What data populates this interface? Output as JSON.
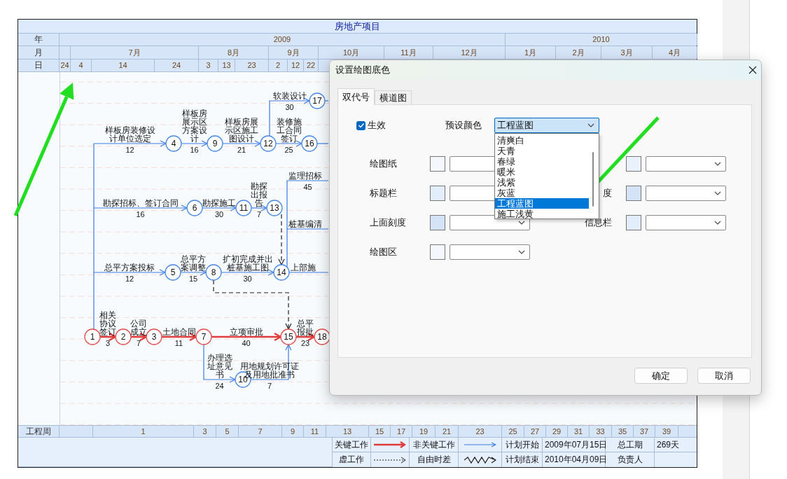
{
  "chart": {
    "title": "房地产项目",
    "scale": {
      "year_label": "年",
      "years": [
        "2009",
        "2010"
      ],
      "month_label": "月",
      "months": [
        "7月",
        "8月",
        "9月",
        "10月",
        "11月",
        "12月",
        "1月",
        "2月",
        "3月",
        "4月"
      ],
      "day_label": "日",
      "days": [
        "24",
        "4",
        "14",
        "24",
        "3",
        "13",
        "23",
        "2",
        "12",
        "22"
      ]
    },
    "nodes": [
      {
        "label": "1",
        "critical": true
      },
      {
        "label": "2",
        "critical": true
      },
      {
        "label": "3",
        "critical": true
      },
      {
        "label": "7",
        "critical": true
      },
      {
        "label": "15",
        "critical": true
      },
      {
        "label": "18",
        "critical": true
      },
      {
        "label": "4",
        "critical": false
      },
      {
        "label": "9",
        "critical": false
      },
      {
        "label": "12",
        "critical": false
      },
      {
        "label": "16",
        "critical": false
      },
      {
        "label": "17",
        "critical": false
      },
      {
        "label": "6",
        "critical": false
      },
      {
        "label": "11",
        "critical": false
      },
      {
        "label": "13",
        "critical": false
      },
      {
        "label": "5",
        "critical": false
      },
      {
        "label": "8",
        "critical": false
      },
      {
        "label": "14",
        "critical": false
      },
      {
        "label": "10",
        "critical": false
      }
    ],
    "activities": [
      {
        "kind": "critical",
        "name": "相关协议签订",
        "duration": "3"
      },
      {
        "kind": "critical",
        "name": "公司成立",
        "duration": "7"
      },
      {
        "kind": "critical",
        "name": "土地合同",
        "duration": "11"
      },
      {
        "kind": "critical",
        "name": "立项审批",
        "duration": "40"
      },
      {
        "kind": "critical",
        "name": "总平报批",
        "duration": "23"
      },
      {
        "kind": "normal",
        "name": "样板房装修设计单位选定",
        "duration": "12"
      },
      {
        "kind": "normal",
        "name": "勘探招标、签订合同",
        "duration": "16"
      },
      {
        "kind": "normal",
        "name": "总平方案投标",
        "duration": "12"
      },
      {
        "kind": "normal",
        "name": "样板房展示区方案设计",
        "duration": "16"
      },
      {
        "kind": "normal",
        "name": "样板房展示区施工图设计",
        "duration": "21"
      },
      {
        "kind": "normal",
        "name": "软装设计",
        "duration": "30"
      },
      {
        "kind": "normal",
        "name": "装修施工合同签订",
        "duration": "25"
      },
      {
        "kind": "normal"
      },
      {
        "kind": "normal"
      },
      {
        "kind": "normal",
        "name": "勘探施工",
        "duration": "30"
      },
      {
        "kind": "normal",
        "name": "勘探出报告",
        "duration": "7"
      },
      {
        "kind": "dummy"
      },
      {
        "kind": "normal",
        "name": "总平方案调整",
        "duration": "15"
      },
      {
        "kind": "normal",
        "name": "扩初完成并出桩基施工图",
        "duration": "30"
      },
      {
        "kind": "dummy"
      },
      {
        "kind": "normal",
        "name": "监理招标",
        "duration": "45"
      },
      {
        "kind": "normal",
        "name": "桩基编清"
      },
      {
        "kind": "normal",
        "name": "上部施"
      },
      {
        "kind": "normal",
        "name": "办理选址意见书",
        "duration": "24"
      },
      {
        "kind": "normal",
        "name": "用地规划许可证及用地批准书",
        "duration": "7"
      }
    ],
    "week_label": "工程周",
    "weeks": [
      "1",
      "3",
      "5",
      "7",
      "9",
      "11",
      "13",
      "15",
      "17",
      "19",
      "21",
      "23",
      "25",
      "27",
      "29",
      "31",
      "33",
      "35",
      "37",
      "39"
    ],
    "legend": {
      "rows": [
        {
          "line_types": [
            {
              "kind": "critical",
              "label": "关键工作"
            },
            {
              "kind": "normal",
              "label": "非关键工作"
            }
          ],
          "info": [
            {
              "label": "计划开始",
              "value": "2009年07月15日"
            },
            {
              "label": "总工期",
              "value": "269天"
            }
          ]
        },
        {
          "line_types": [
            {
              "kind": "dummy",
              "label": "虚工作"
            },
            {
              "kind": "float",
              "label": "自由时差"
            }
          ],
          "info": [
            {
              "label": "计划结束",
              "value": "2010年04月09日"
            },
            {
              "label": "负责人"
            }
          ]
        }
      ]
    }
  },
  "dialog": {
    "title": "设置绘图底色",
    "tabs": [
      {
        "label": "双代号",
        "selected": true
      },
      {
        "label": "横道图",
        "selected": false
      }
    ],
    "enabled": {
      "label": "生效",
      "checked": true
    },
    "preset": {
      "label": "预设颜色",
      "value": "工程蓝图",
      "expanded": true,
      "options": [
        {
          "label": "清爽白",
          "selected": false
        },
        {
          "label": "天青",
          "selected": false
        },
        {
          "label": "春绿",
          "selected": false
        },
        {
          "label": "暖米",
          "selected": false
        },
        {
          "label": "浅紫",
          "selected": false
        },
        {
          "label": "灰蓝",
          "selected": false
        },
        {
          "label": "工程蓝图",
          "selected": true
        },
        {
          "label": "施工浅黄",
          "selected": false
        }
      ]
    },
    "colors": [
      {
        "label": "绘图纸",
        "color": "#f4f7fb"
      },
      {
        "label": "标题栏",
        "color": "#e3eefc"
      },
      {
        "label": "上面刻度",
        "color": "#d5e3f7"
      },
      {
        "label": "绘图区",
        "color": "#f4f8fc"
      }
    ],
    "colors_right": [
      {
        "color": "#eaf1fb"
      },
      {
        "label": "度",
        "color": "#d5e3f7"
      },
      {
        "label": "信息栏",
        "color": "#e3eefc"
      }
    ],
    "buttons": [
      "确定",
      "取消"
    ]
  }
}
